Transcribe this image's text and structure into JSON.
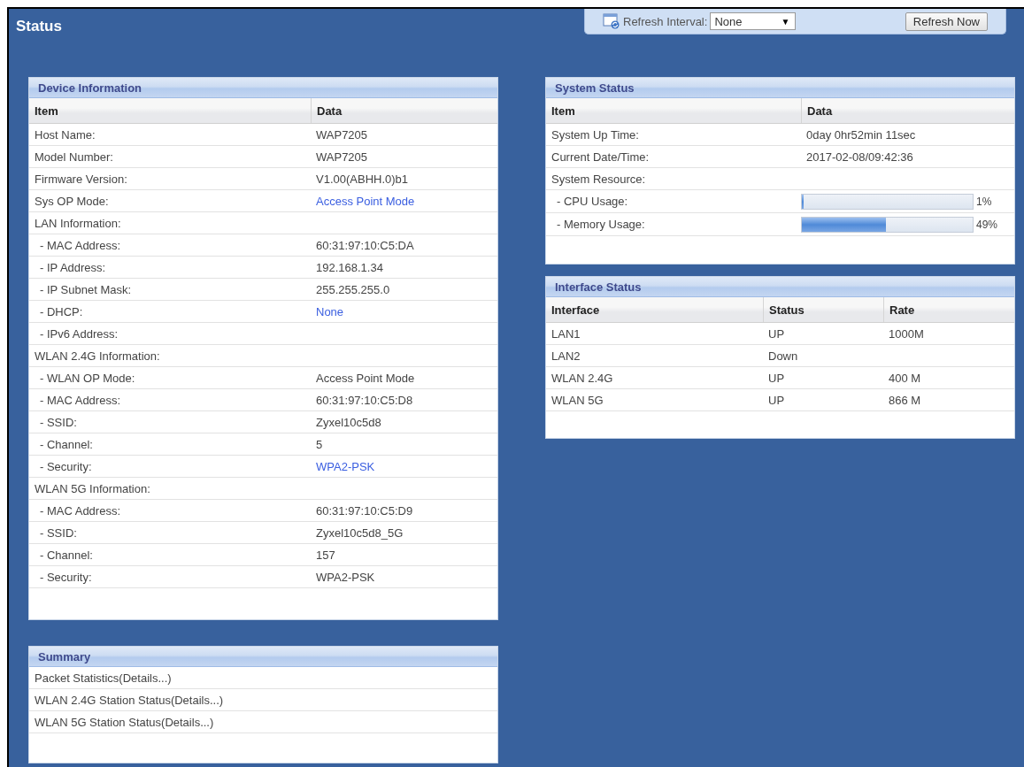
{
  "page_title": "Status",
  "toolbar": {
    "refresh_interval_label": "Refresh Interval:",
    "refresh_interval_value": "None",
    "dropdown_arrow": "▼",
    "refresh_button": "Refresh Now"
  },
  "device_information": {
    "title": "Device Information",
    "columns": [
      "Item",
      "Data"
    ],
    "rows": [
      {
        "label": "Host Name:",
        "value": "WAP7205",
        "link": false
      },
      {
        "label": "Model Number:",
        "value": "WAP7205",
        "link": false
      },
      {
        "label": "Firmware Version:",
        "value": "V1.00(ABHH.0)b1",
        "link": false
      },
      {
        "label": "Sys OP Mode:",
        "value": "Access Point Mode",
        "link": true
      },
      {
        "label": "LAN Information:",
        "children": [
          {
            "label": "- MAC Address:",
            "value": "60:31:97:10:C5:DA",
            "link": false
          },
          {
            "label": "- IP Address:",
            "value": "192.168.1.34",
            "link": false
          },
          {
            "label": "- IP Subnet Mask:",
            "value": "255.255.255.0",
            "link": false
          },
          {
            "label": "- DHCP:",
            "value": "None",
            "link": true
          },
          {
            "label": "- IPv6 Address:"
          }
        ]
      },
      {
        "label": "WLAN 2.4G Information:",
        "children": [
          {
            "label": "- WLAN OP Mode:",
            "value": "Access Point Mode",
            "link": false
          },
          {
            "label": "- MAC Address:",
            "value": "60:31:97:10:C5:D8",
            "link": false
          },
          {
            "label": "- SSID:",
            "value": "Zyxel10c5d8",
            "link": false
          },
          {
            "label": "- Channel:",
            "value": "5",
            "link": false
          },
          {
            "label": "- Security:",
            "value": "WPA2-PSK",
            "link": true
          }
        ]
      },
      {
        "label": "WLAN 5G Information:",
        "children": [
          {
            "label": "- MAC Address:",
            "value": "60:31:97:10:C5:D9",
            "link": false
          },
          {
            "label": "- SSID:",
            "value": "Zyxel10c5d8_5G",
            "link": false
          },
          {
            "label": "- Channel:",
            "value": "157",
            "link": false
          },
          {
            "label": "- Security:",
            "value": "WPA2-PSK",
            "link": false
          }
        ]
      }
    ]
  },
  "summary": {
    "title": "Summary",
    "items": [
      "Packet Statistics(Details...)",
      "WLAN 2.4G Station Status(Details...)",
      "WLAN 5G Station Status(Details...)"
    ]
  },
  "system_status": {
    "title": "System Status",
    "columns": [
      "Item",
      "Data"
    ],
    "rows": [
      {
        "label": "System Up Time:",
        "value": "0day 0hr52min 11sec"
      },
      {
        "label": "Current Date/Time:",
        "value": "2017-02-08/09:42:36"
      },
      {
        "label": "System Resource:",
        "children": [
          {
            "kind": "meter",
            "label": "- CPU Usage:",
            "level": 0.01,
            "reading": "1%"
          },
          {
            "kind": "meter",
            "label": "- Memory Usage:",
            "level": 0.49,
            "reading": "49%"
          }
        ]
      }
    ]
  },
  "interface_status": {
    "title": "Interface Status",
    "columns": [
      "Interface",
      "Status",
      "Rate"
    ],
    "rows": [
      [
        "LAN1",
        "UP",
        "1000M"
      ],
      [
        "LAN2",
        "Down",
        ""
      ],
      [
        "WLAN 2.4G",
        "UP",
        "400 M"
      ],
      [
        "WLAN 5G",
        "UP",
        "866 M"
      ]
    ]
  }
}
